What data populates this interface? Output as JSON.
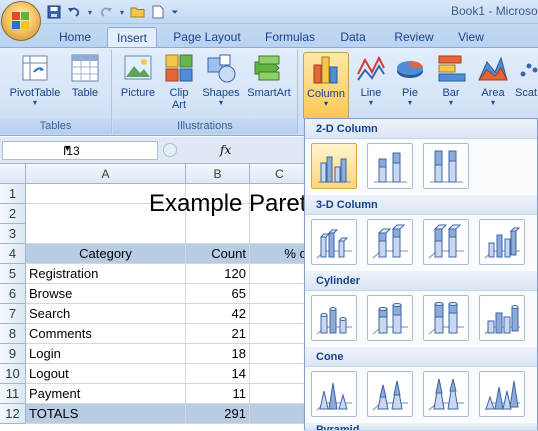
{
  "window": {
    "title": "Book1 - Microso"
  },
  "tabs": [
    "Home",
    "Insert",
    "Page Layout",
    "Formulas",
    "Data",
    "Review",
    "View"
  ],
  "active_tab": "Insert",
  "ribbon": {
    "groups": {
      "tables": "Tables",
      "illustrations": "Illustrations"
    },
    "buttons": {
      "pivottable": "PivotTable",
      "table": "Table",
      "picture": "Picture",
      "clipart_1": "Clip",
      "clipart_2": "Art",
      "shapes": "Shapes",
      "smartart": "SmartArt",
      "column": "Column",
      "line": "Line",
      "pie": "Pie",
      "bar": "Bar",
      "area": "Area",
      "scatter": "Scat"
    }
  },
  "formula_bar": {
    "name_box": "I13",
    "fx": "fx",
    "formula": ""
  },
  "columns": [
    "A",
    "B",
    "C"
  ],
  "rows": [
    "1",
    "2",
    "3",
    "4",
    "5",
    "6",
    "7",
    "8",
    "9",
    "10",
    "11",
    "12"
  ],
  "sheet": {
    "title": "Example Paret",
    "header": {
      "category": "Category",
      "count": "Count",
      "pct": "% c"
    },
    "data": [
      {
        "category": "Registration",
        "count": "120"
      },
      {
        "category": "Browse",
        "count": "65"
      },
      {
        "category": "Search",
        "count": "42"
      },
      {
        "category": "Comments",
        "count": "21"
      },
      {
        "category": "Login",
        "count": "18"
      },
      {
        "category": "Logout",
        "count": "14"
      },
      {
        "category": "Payment",
        "count": "11"
      }
    ],
    "totals": {
      "label": "TOTALS",
      "count": "291"
    }
  },
  "gallery": {
    "sections": [
      "2-D Column",
      "3-D Column",
      "Cylinder",
      "Cone",
      "Pyramid"
    ]
  },
  "colors": {
    "accent_header": "#b8cce4",
    "ribbon": "#d5e4f7",
    "selected": "#fcd77c"
  }
}
